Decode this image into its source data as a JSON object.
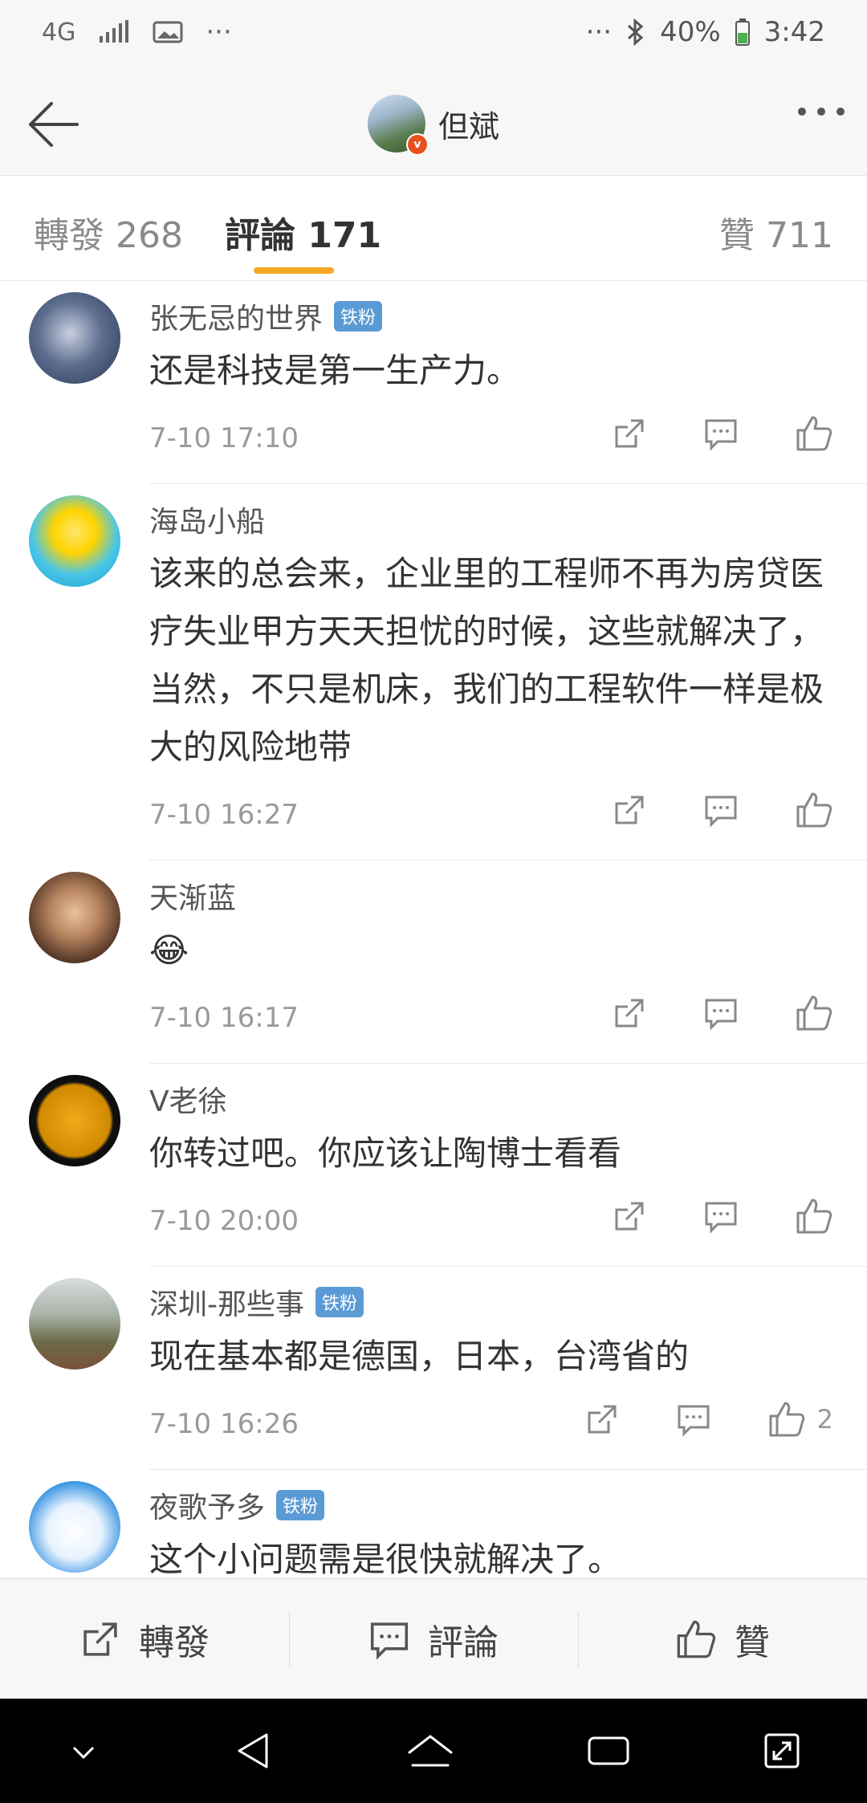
{
  "status": {
    "network": "4G",
    "battery": "40%",
    "time": "3:42"
  },
  "header": {
    "title": "但斌"
  },
  "tabs": [
    {
      "label": "轉發 268"
    },
    {
      "label": "評論 171"
    },
    {
      "label": "贊 711"
    }
  ],
  "comments": [
    {
      "user": "张无忌的世界",
      "fan": "铁粉",
      "text": "还是科技是第一生产力。",
      "time": "7-10 17:10",
      "likes": ""
    },
    {
      "user": "海岛小船",
      "fan": "",
      "text": "该来的总会来，企业里的工程师不再为房贷医疗失业甲方天天担忧的时候，这些就解决了，当然，不只是机床，我们的工程软件一样是极大的风险地带",
      "time": "7-10 16:27",
      "likes": ""
    },
    {
      "user": "天渐蓝",
      "fan": "",
      "text": "😂",
      "time": "7-10 16:17",
      "likes": ""
    },
    {
      "user": "V老徐",
      "fan": "",
      "text": "你转过吧。你应该让陶博士看看",
      "time": "7-10 20:00",
      "likes": ""
    },
    {
      "user": "深圳-那些事",
      "fan": "铁粉",
      "text": "现在基本都是德国，日本，台湾省的",
      "time": "7-10 16:26",
      "likes": "2"
    },
    {
      "user": "夜歌予多",
      "fan": "铁粉",
      "text": "这个小问题需是很快就解决了。",
      "time": "",
      "likes": ""
    }
  ],
  "bottom": {
    "repost": "轉發",
    "comment": "評論",
    "like": "贊"
  }
}
